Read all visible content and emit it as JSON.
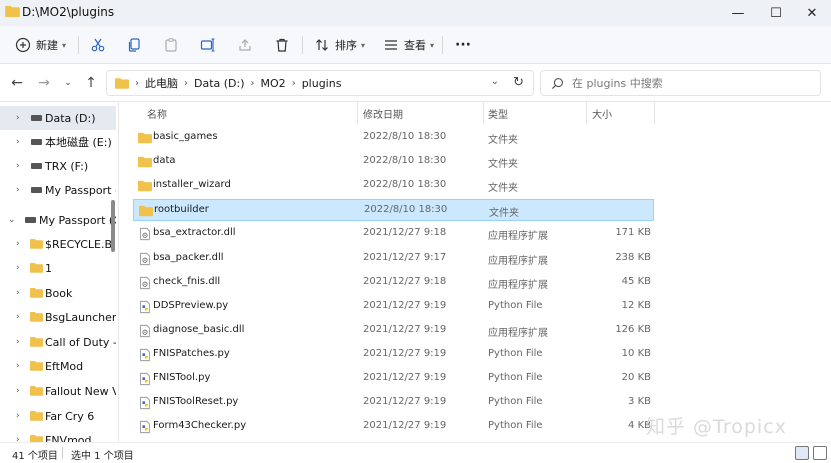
{
  "window": {
    "title": "D:\\MO2\\plugins",
    "minimize_glyph": "—",
    "maximize_glyph": "☐",
    "close_glyph": "✕"
  },
  "toolbar": {
    "new_label": "新建",
    "sort_label": "排序",
    "view_label": "查看",
    "more_label": "···"
  },
  "address": {
    "crumbs": [
      "此电脑",
      "Data (D:)",
      "MO2",
      "plugins"
    ],
    "search_placeholder": "在 plugins 中搜索"
  },
  "sidebar": {
    "items": [
      {
        "label": "Data (D:)",
        "icon": "drive-icon",
        "expanded": false,
        "selected": true
      },
      {
        "label": "本地磁盘 (E:)",
        "icon": "drive-icon",
        "expanded": false,
        "selected": false
      },
      {
        "label": "TRX (F:)",
        "icon": "drive-icon",
        "expanded": false,
        "selected": false
      },
      {
        "label": "My Passport (G:)",
        "icon": "drive-icon",
        "expanded": false,
        "selected": false
      },
      {
        "label": "My Passport (G:)",
        "icon": "drive-icon",
        "expanded": true,
        "selected": false
      },
      {
        "label": "$RECYCLE.BIN",
        "icon": "folder-icon",
        "expanded": false,
        "selected": false
      },
      {
        "label": "1",
        "icon": "folder-icon",
        "expanded": false,
        "selected": false
      },
      {
        "label": "Book",
        "icon": "folder-icon",
        "expanded": false,
        "selected": false
      },
      {
        "label": "BsgLauncher",
        "icon": "folder-icon",
        "expanded": false,
        "selected": false
      },
      {
        "label": "Call of Duty - I",
        "icon": "folder-icon",
        "expanded": false,
        "selected": false
      },
      {
        "label": "EftMod",
        "icon": "folder-icon",
        "expanded": false,
        "selected": false
      },
      {
        "label": "Fallout New Ve",
        "icon": "folder-icon",
        "expanded": false,
        "selected": false
      },
      {
        "label": "Far Cry 6",
        "icon": "folder-icon",
        "expanded": false,
        "selected": false
      },
      {
        "label": "FNVmod",
        "icon": "folder-icon",
        "expanded": false,
        "selected": false
      }
    ]
  },
  "columns": {
    "name": "名称",
    "date": "修改日期",
    "type": "类型",
    "size": "大小"
  },
  "files": [
    {
      "name": "basic_games",
      "date": "2022/8/10 18:30",
      "type": "文件夹",
      "size": "",
      "icon": "folder-icon",
      "selected": false
    },
    {
      "name": "data",
      "date": "2022/8/10 18:30",
      "type": "文件夹",
      "size": "",
      "icon": "folder-icon",
      "selected": false
    },
    {
      "name": "installer_wizard",
      "date": "2022/8/10 18:30",
      "type": "文件夹",
      "size": "",
      "icon": "folder-icon",
      "selected": false
    },
    {
      "name": "rootbuilder",
      "date": "2022/8/10 18:30",
      "type": "文件夹",
      "size": "",
      "icon": "folder-icon",
      "selected": true
    },
    {
      "name": "bsa_extractor.dll",
      "date": "2021/12/27 9:18",
      "type": "应用程序扩展",
      "size": "171 KB",
      "icon": "dll-icon",
      "selected": false
    },
    {
      "name": "bsa_packer.dll",
      "date": "2021/12/27 9:17",
      "type": "应用程序扩展",
      "size": "238 KB",
      "icon": "dll-icon",
      "selected": false
    },
    {
      "name": "check_fnis.dll",
      "date": "2021/12/27 9:18",
      "type": "应用程序扩展",
      "size": "45 KB",
      "icon": "dll-icon",
      "selected": false
    },
    {
      "name": "DDSPreview.py",
      "date": "2021/12/27 9:19",
      "type": "Python File",
      "size": "12 KB",
      "icon": "python-file-icon",
      "selected": false
    },
    {
      "name": "diagnose_basic.dll",
      "date": "2021/12/27 9:19",
      "type": "应用程序扩展",
      "size": "126 KB",
      "icon": "dll-icon",
      "selected": false
    },
    {
      "name": "FNISPatches.py",
      "date": "2021/12/27 9:19",
      "type": "Python File",
      "size": "10 KB",
      "icon": "python-file-icon",
      "selected": false
    },
    {
      "name": "FNISTool.py",
      "date": "2021/12/27 9:19",
      "type": "Python File",
      "size": "20 KB",
      "icon": "python-file-icon",
      "selected": false
    },
    {
      "name": "FNISToolReset.py",
      "date": "2021/12/27 9:19",
      "type": "Python File",
      "size": "3 KB",
      "icon": "python-file-icon",
      "selected": false
    },
    {
      "name": "Form43Checker.py",
      "date": "2021/12/27 9:19",
      "type": "Python File",
      "size": "4 KB",
      "icon": "python-file-icon",
      "selected": false
    }
  ],
  "status": {
    "count": "41 个项目",
    "selection": "选中 1 个项目"
  },
  "watermark": "知乎 @Tropicx",
  "colors": {
    "folder": "#f0c24b",
    "selection_bg": "#cce8ff",
    "selection_border": "#99d1ff",
    "accent": "#1a73e8"
  }
}
